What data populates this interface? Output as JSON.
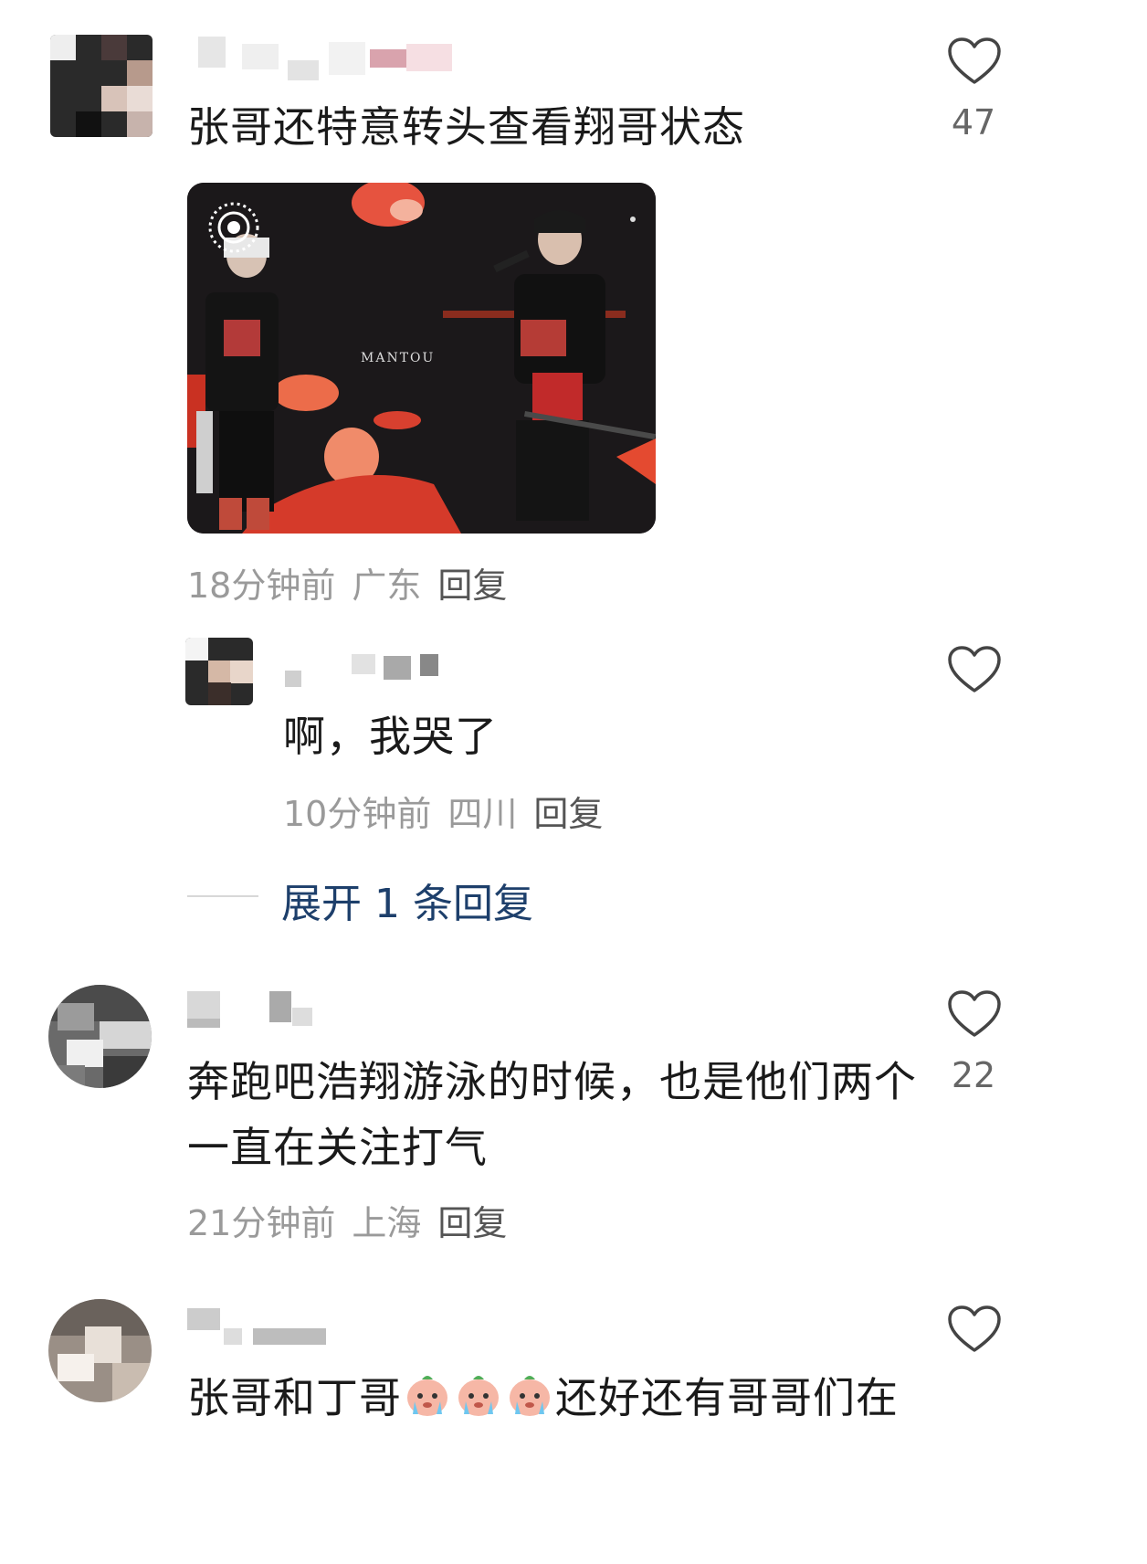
{
  "comments": [
    {
      "text": "张哥还特意转头查看翔哥状态",
      "meta_time": "18分钟前",
      "meta_location": "广东",
      "reply_label": "回复",
      "likes": "47",
      "photo_caption": "MANTOU",
      "replies": [
        {
          "text": "啊，我哭了",
          "meta_time": "10分钟前",
          "meta_location": "四川",
          "reply_label": "回复"
        }
      ],
      "expand_label": "展开 1 条回复"
    },
    {
      "text_line1": "奔跑吧浩翔游泳的时候，也是他们两个",
      "text_line2": "一直在关注打气",
      "meta_time": "21分钟前",
      "meta_location": "上海",
      "reply_label": "回复",
      "likes": "22"
    },
    {
      "text_before": "张哥和丁哥",
      "text_after": "还好还有哥哥们在"
    }
  ],
  "icons": {
    "like": "heart-outline-icon",
    "photo_badge": "live-photo-icon",
    "emoji": "crying-peach-emoji"
  },
  "colors": {
    "link": "#1d3f6b",
    "meta": "#9a9a9a",
    "text": "#1a1a1a"
  }
}
